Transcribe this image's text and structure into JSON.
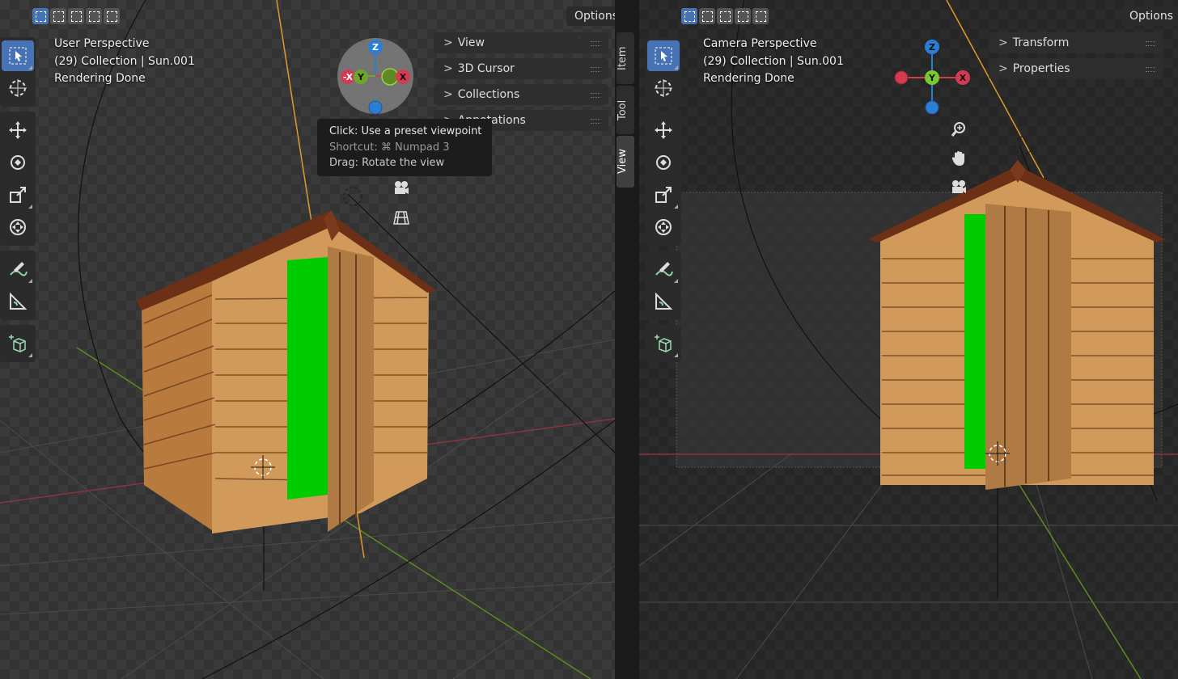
{
  "header": {
    "options_label": "Options"
  },
  "left_viewport": {
    "info_lines": [
      "User Perspective",
      "(29) Collection | Sun.001",
      "Rendering Done"
    ],
    "gizmo_labels": {
      "z": "Z",
      "y": "Y",
      "neg_x": "-X",
      "x": "X"
    },
    "sidebar_panels": [
      "View",
      "3D Cursor",
      "Collections",
      "Annotations"
    ],
    "side_tabs": [
      "Item",
      "Tool",
      "View"
    ],
    "tooltip": {
      "line1": "Click: Use a preset viewpoint",
      "line2": "Shortcut: ⌘ Numpad 3",
      "line3": "Drag: Rotate the view"
    }
  },
  "right_viewport": {
    "info_lines": [
      "Camera Perspective",
      "(29) Collection | Sun.001",
      "Rendering Done"
    ],
    "gizmo_labels": {
      "z": "Z",
      "y": "Y",
      "x": "X"
    },
    "sidebar_panels": [
      "Transform",
      "Properties"
    ]
  },
  "colors": {
    "accent": "#4772b3",
    "x_axis": "#d43b52",
    "y_axis": "#6ea62a",
    "z_axis": "#2a7fd4",
    "green_screen": "#00cc00"
  },
  "icons": [
    "select-box-icon",
    "cursor-icon",
    "move-icon",
    "rotate-icon",
    "scale-icon",
    "transform-icon",
    "annotate-icon",
    "measure-icon",
    "add-cube-icon",
    "zoom-icon",
    "hand-pan-icon",
    "camera-icon",
    "grid-icon"
  ]
}
